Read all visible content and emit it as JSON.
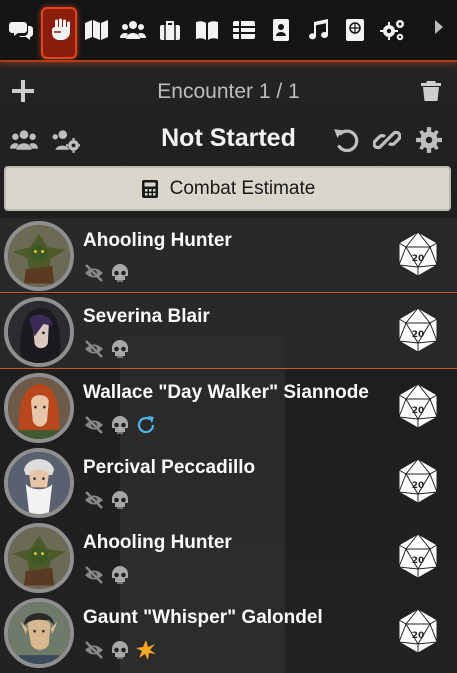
{
  "tabs": [
    {
      "name": "chat",
      "icon": "chat-icon",
      "active": false
    },
    {
      "name": "combat",
      "icon": "fist-icon",
      "active": true
    },
    {
      "name": "scenes",
      "icon": "map-icon",
      "active": false
    },
    {
      "name": "actors",
      "icon": "users-icon",
      "active": false
    },
    {
      "name": "items",
      "icon": "suitcase-icon",
      "active": false
    },
    {
      "name": "journal",
      "icon": "book-icon",
      "active": false
    },
    {
      "name": "tables",
      "icon": "table-icon",
      "active": false
    },
    {
      "name": "cards",
      "icon": "id-card-icon",
      "active": false
    },
    {
      "name": "playlists",
      "icon": "music-icon",
      "active": false
    },
    {
      "name": "compendium",
      "icon": "atlas-icon",
      "active": false
    },
    {
      "name": "settings",
      "icon": "cogs-icon",
      "active": false
    }
  ],
  "encounter": {
    "title": "Encounter 1 / 1",
    "status": "Not Started",
    "estimate_label": "Combat Estimate"
  },
  "combatants": [
    {
      "name": "Ahooling Hunter",
      "portrait": "goblin-hunter",
      "status_icons": [
        "eye-slash-icon",
        "skull-icon"
      ],
      "highlighted": true
    },
    {
      "name": "Severina Blair",
      "portrait": "hooded-woman",
      "status_icons": [
        "eye-slash-icon",
        "skull-icon"
      ],
      "highlighted": true
    },
    {
      "name": "Wallace \"Day Walker\" Siannode",
      "portrait": "red-hair",
      "status_icons": [
        "eye-slash-icon",
        "skull-icon",
        "refresh-icon"
      ],
      "highlighted": false
    },
    {
      "name": "Percival Peccadillo",
      "portrait": "old-wizard",
      "status_icons": [
        "eye-slash-icon",
        "skull-icon"
      ],
      "highlighted": false
    },
    {
      "name": "Ahooling Hunter",
      "portrait": "goblin-hunter",
      "status_icons": [
        "eye-slash-icon",
        "skull-icon"
      ],
      "highlighted": false
    },
    {
      "name": "Gaunt \"Whisper\" Galondel",
      "portrait": "elf",
      "status_icons": [
        "eye-slash-icon",
        "skull-icon",
        "starburst-icon"
      ],
      "highlighted": false
    }
  ],
  "colors": {
    "accent": "#e0461c",
    "refresh": "#4fb4e8",
    "starburst": "#f5a623"
  }
}
